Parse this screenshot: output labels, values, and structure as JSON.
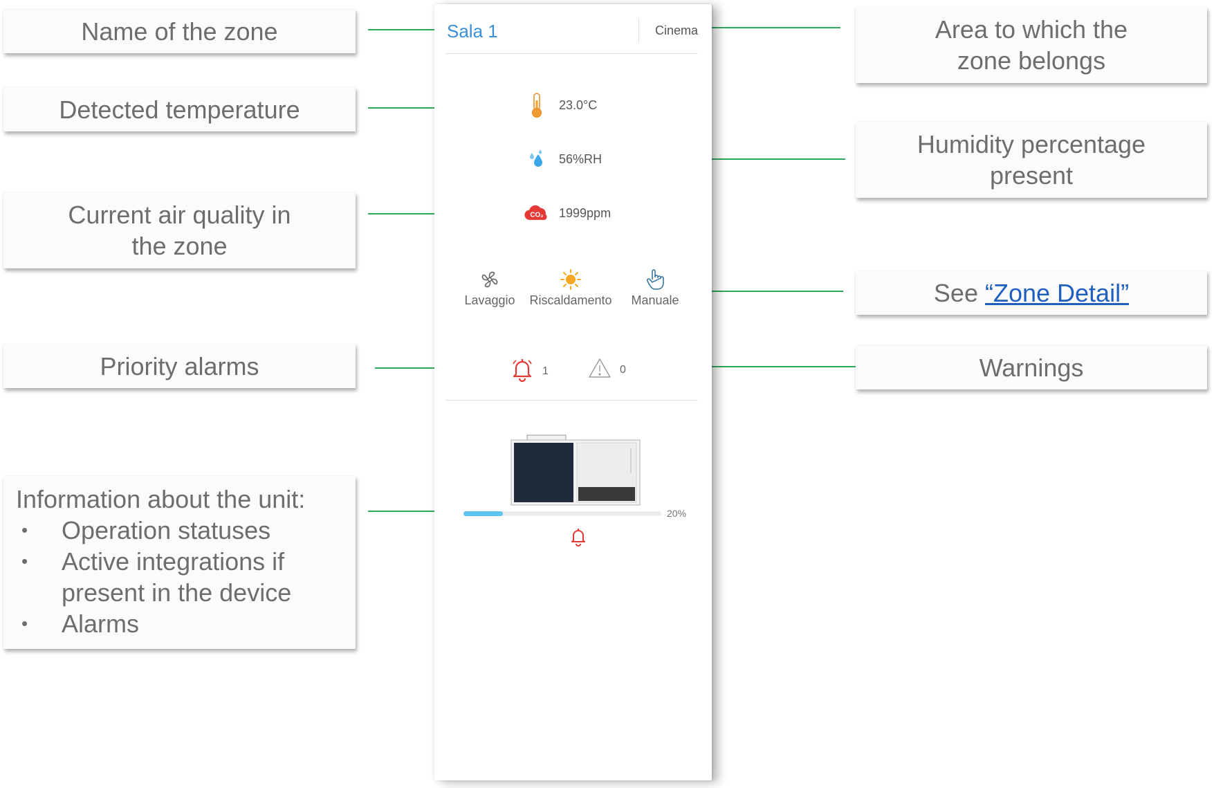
{
  "card": {
    "zone_name": "Sala 1",
    "area_name": "Cinema",
    "temperature": "23.0°C",
    "humidity": "56%RH",
    "co2": "1999ppm",
    "statuses": [
      {
        "label": "Lavaggio",
        "icon": "fan-icon"
      },
      {
        "label": "Riscaldamento",
        "icon": "sun-icon"
      },
      {
        "label": "Manuale",
        "icon": "hand-pointer-icon"
      }
    ],
    "alarms": {
      "priority_count": "1",
      "warning_count": "0"
    },
    "unit": {
      "progress_label": "20%",
      "progress_value": 0.2
    }
  },
  "callouts": {
    "zone_name": "Name of the zone",
    "temperature": "Detected temperature",
    "air_quality": "Current air quality in the zone",
    "priority_alarms": "Priority alarms",
    "unit_info": {
      "title": "Information about the unit:",
      "items": [
        "Operation statuses",
        "Active integrations if present in the device",
        "Alarms"
      ]
    },
    "area": "Area to which the zone belongs",
    "humidity": "Humidity percentage present",
    "zone_detail_prefix": "See ",
    "zone_detail_link": "“Zone Detail”",
    "warnings": "Warnings"
  },
  "colors": {
    "accent_blue": "#3b8fd6",
    "connector_green": "#2ea85a",
    "alarm_red": "#e53935",
    "progress_blue": "#5ec4ef",
    "sun_orange": "#f5a623"
  }
}
